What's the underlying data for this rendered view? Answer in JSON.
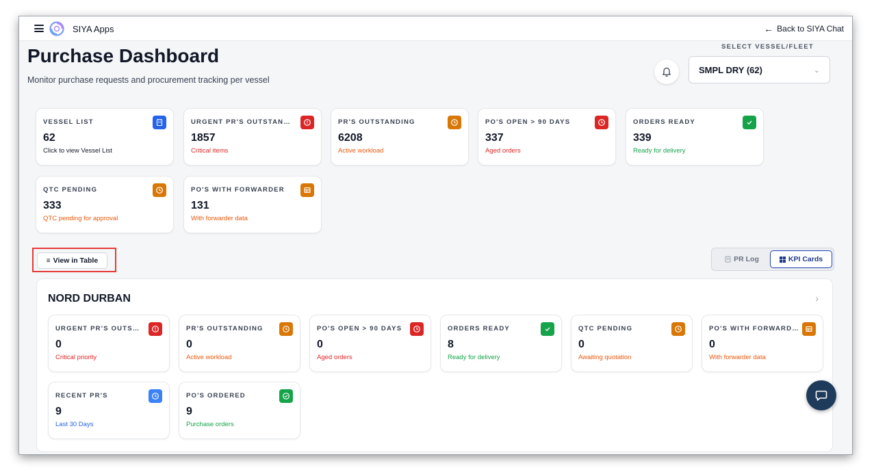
{
  "topbar": {
    "app_name": "SIYA Apps",
    "back_label": "Back to SIYA Chat"
  },
  "header": {
    "title": "Purchase Dashboard",
    "subtitle": "Monitor purchase requests and procurement tracking per vessel",
    "select_label": "SELECT VESSEL/FLEET",
    "select_value": "SMPL DRY (62)"
  },
  "kpi_cards": [
    {
      "title": "VESSEL LIST",
      "value": "62",
      "sub": "Click to view Vessel List",
      "sub_color": "#111827",
      "icon": "building-icon",
      "icon_color": "#2563eb"
    },
    {
      "title": "URGENT PR'S OUTSTANDI...",
      "value": "1857",
      "sub": "Critical items",
      "sub_color": "#dc2626",
      "icon": "alert-circle-icon",
      "icon_color": "#dc2626"
    },
    {
      "title": "PR'S OUTSTANDING",
      "value": "6208",
      "sub": "Active workload",
      "sub_color": "#ea580c",
      "icon": "clock-icon",
      "icon_color": "#d97706"
    },
    {
      "title": "PO'S OPEN > 90 DAYS",
      "value": "337",
      "sub": "Aged orders",
      "sub_color": "#dc2626",
      "icon": "clock-icon",
      "icon_color": "#dc2626"
    },
    {
      "title": "ORDERS READY",
      "value": "339",
      "sub": "Ready for delivery",
      "sub_color": "#16a34a",
      "icon": "check-icon",
      "icon_color": "#16a34a"
    },
    {
      "title": "QTC PENDING",
      "value": "333",
      "sub": "QTC pending for approval",
      "sub_color": "#ea580c",
      "icon": "clock-icon",
      "icon_color": "#d97706"
    },
    {
      "title": "PO'S WITH FORWARDER",
      "value": "131",
      "sub": "With forwarder data",
      "sub_color": "#ea580c",
      "icon": "table-icon",
      "icon_color": "#d97706"
    }
  ],
  "controls": {
    "view_table_label": "View in Table",
    "pr_log_label": "PR Log",
    "kpi_cards_label": "KPI Cards"
  },
  "vessel": {
    "name": "NORD DURBAN",
    "cards": [
      {
        "title": "URGENT PR'S OUTSTA...",
        "value": "0",
        "sub": "Critical priority",
        "sub_color": "#dc2626",
        "icon": "alert-circle-icon",
        "icon_color": "#dc2626"
      },
      {
        "title": "PR'S OUTSTANDING",
        "value": "0",
        "sub": "Active workload",
        "sub_color": "#ea580c",
        "icon": "clock-icon",
        "icon_color": "#d97706"
      },
      {
        "title": "PO'S OPEN > 90 DAYS",
        "value": "0",
        "sub": "Aged orders",
        "sub_color": "#dc2626",
        "icon": "clock-icon",
        "icon_color": "#dc2626"
      },
      {
        "title": "ORDERS READY",
        "value": "8",
        "sub": "Ready for delivery",
        "sub_color": "#16a34a",
        "icon": "check-icon",
        "icon_color": "#16a34a"
      },
      {
        "title": "QTC PENDING",
        "value": "0",
        "sub": "Awaiting quotation",
        "sub_color": "#ea580c",
        "icon": "clock-icon",
        "icon_color": "#d97706"
      },
      {
        "title": "PO'S WITH FORWARDER",
        "value": "0",
        "sub": "With forwarder data",
        "sub_color": "#ea580c",
        "icon": "table-icon",
        "icon_color": "#d97706"
      },
      {
        "title": "RECENT PR'S",
        "value": "9",
        "sub": "Last 30 Days",
        "sub_color": "#2563eb",
        "icon": "clock-icon",
        "icon_color": "#3b82f6"
      },
      {
        "title": "PO'S ORDERED",
        "value": "9",
        "sub": "Purchase orders",
        "sub_color": "#16a34a",
        "icon": "check-circle-icon",
        "icon_color": "#16a34a"
      }
    ]
  }
}
